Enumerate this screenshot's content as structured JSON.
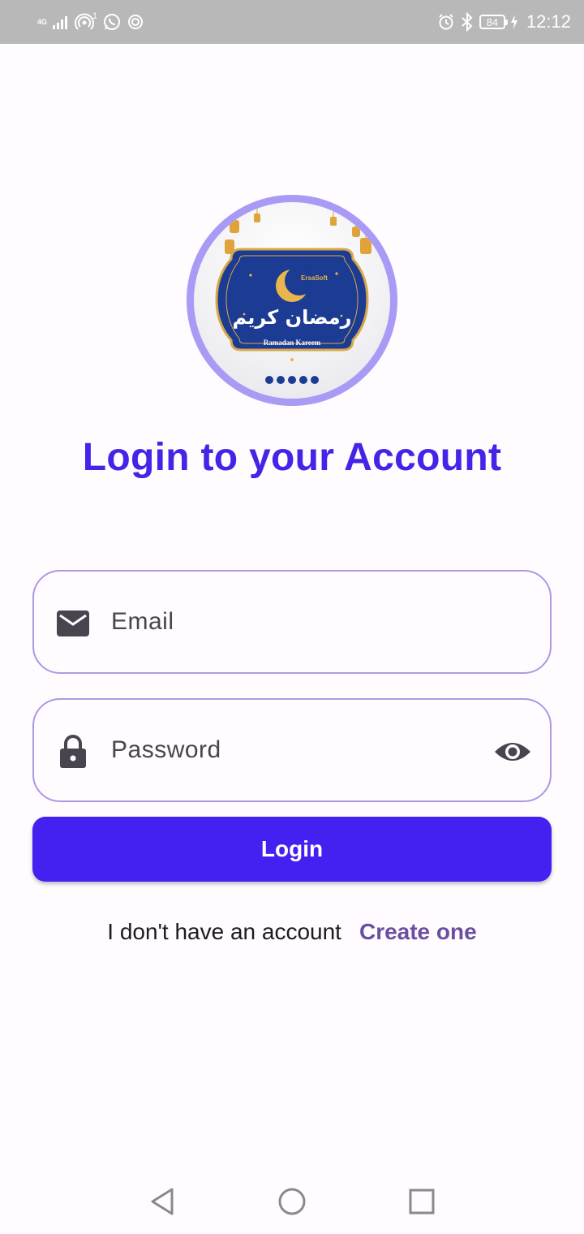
{
  "status_bar": {
    "network_label": "4G",
    "hotspot_badge": "1",
    "battery": "84",
    "time": "12:12",
    "icons": [
      "signal-icon",
      "hotspot-icon",
      "whatsapp-icon",
      "location-icon",
      "alarm-icon",
      "bluetooth-icon",
      "battery-icon",
      "charging-icon"
    ]
  },
  "logo": {
    "brand": "ErsaSoft",
    "arabic_text": "رمضان كريم",
    "caption": "Ramadan Kareem",
    "icon": "ramadan-kareem-logo"
  },
  "title": "Login to your Account",
  "email_field": {
    "placeholder": "Email",
    "value": "",
    "icon": "email-icon"
  },
  "password_field": {
    "placeholder": "Password",
    "value": "",
    "icon": "lock-icon",
    "toggle_icon": "eye-icon"
  },
  "login_button": {
    "label": "Login"
  },
  "footer": {
    "prompt": "I don't have an account",
    "link": "Create one"
  },
  "nav_bar": {
    "icons": [
      "back-icon",
      "home-icon",
      "recents-icon"
    ]
  },
  "colors": {
    "primary": "#4520f0",
    "title": "#4424e6",
    "link": "#6a4fa0",
    "field_border": "#ab9ae0",
    "avatar_ring": "#a89af5",
    "background": "#fffbfe"
  }
}
